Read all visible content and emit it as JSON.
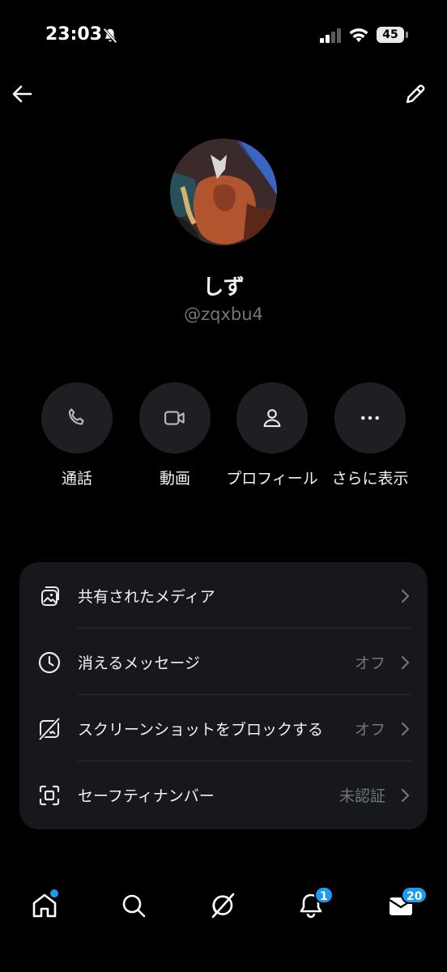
{
  "status_bar": {
    "time": "23:03",
    "battery": "45",
    "icons": [
      "bell-slash-icon",
      "signal-icon",
      "wifi-icon",
      "battery-icon"
    ]
  },
  "header": {
    "back_icon": "arrow-left-icon",
    "edit_icon": "pencil-icon"
  },
  "profile": {
    "display_name": "しず",
    "handle": "@zqxbu4"
  },
  "actions": [
    {
      "label": "通話",
      "icon": "phone-icon"
    },
    {
      "label": "動画",
      "icon": "video-icon"
    },
    {
      "label": "プロフィール",
      "icon": "person-icon"
    },
    {
      "label": "さらに表示",
      "icon": "more-icon"
    }
  ],
  "settings": [
    {
      "label": "共有されたメディア",
      "value": "",
      "icon": "media-icon"
    },
    {
      "label": "消えるメッセージ",
      "value": "オフ",
      "icon": "clock-icon"
    },
    {
      "label": "スクリーンショットをブロックする",
      "value": "オフ",
      "icon": "no-screenshot-icon"
    },
    {
      "label": "セーフティナンバー",
      "value": "未認証",
      "icon": "scan-icon"
    }
  ],
  "tab_bar": {
    "notifications_badge": "1",
    "messages_badge": "20",
    "accent_color": "#1d9bf0"
  }
}
